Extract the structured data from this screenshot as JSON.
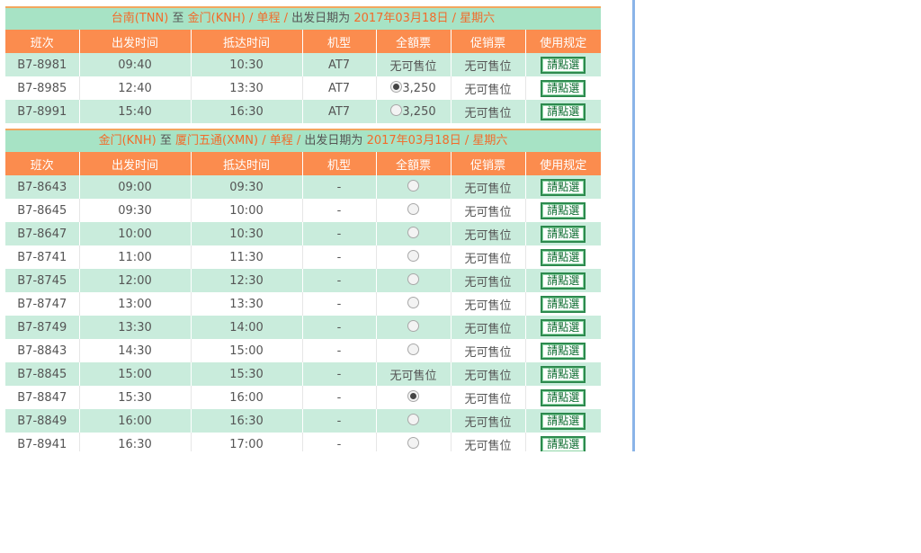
{
  "segment1": {
    "route": {
      "origin": "台南(TNN)",
      "to_word": "至",
      "dest": "金门(KNH)",
      "slash1": "/",
      "trip_type": "单程",
      "slash2": "/",
      "date_label": "出发日期为",
      "date": "2017年03月18日",
      "slash3": "/",
      "weekday": "星期六"
    },
    "headers": [
      "班次",
      "出发时间",
      "抵达时间",
      "机型",
      "全額票",
      "促销票",
      "使用规定"
    ],
    "rows": [
      {
        "flight": "B7-8981",
        "dep": "09:40",
        "arr": "10:30",
        "type": "AT7",
        "full": "无可售位",
        "full_radio": "none",
        "promo": "无可售位",
        "rule": "請點選"
      },
      {
        "flight": "B7-8985",
        "dep": "12:40",
        "arr": "13:30",
        "type": "AT7",
        "full": "3,250",
        "full_radio": "selected",
        "promo": "无可售位",
        "rule": "請點選"
      },
      {
        "flight": "B7-8991",
        "dep": "15:40",
        "arr": "16:30",
        "type": "AT7",
        "full": "3,250",
        "full_radio": "unselected",
        "promo": "无可售位",
        "rule": "請點選"
      }
    ]
  },
  "segment2": {
    "route": {
      "origin": "金门(KNH)",
      "to_word": "至",
      "dest": "厦门五通(XMN)",
      "slash1": "/",
      "trip_type": "单程",
      "slash2": "/",
      "date_label": "出发日期为",
      "date": "2017年03月18日",
      "slash3": "/",
      "weekday": "星期六"
    },
    "headers": [
      "班次",
      "出发时间",
      "抵达时间",
      "机型",
      "全額票",
      "促销票",
      "使用规定"
    ],
    "rows": [
      {
        "flight": "B7-8643",
        "dep": "09:00",
        "arr": "09:30",
        "type": "-",
        "full": "",
        "full_radio": "unselected",
        "promo": "无可售位",
        "rule": "請點選"
      },
      {
        "flight": "B7-8645",
        "dep": "09:30",
        "arr": "10:00",
        "type": "-",
        "full": "",
        "full_radio": "unselected",
        "promo": "无可售位",
        "rule": "請點選"
      },
      {
        "flight": "B7-8647",
        "dep": "10:00",
        "arr": "10:30",
        "type": "-",
        "full": "",
        "full_radio": "unselected",
        "promo": "无可售位",
        "rule": "請點選"
      },
      {
        "flight": "B7-8741",
        "dep": "11:00",
        "arr": "11:30",
        "type": "-",
        "full": "",
        "full_radio": "unselected",
        "promo": "无可售位",
        "rule": "請點選"
      },
      {
        "flight": "B7-8745",
        "dep": "12:00",
        "arr": "12:30",
        "type": "-",
        "full": "",
        "full_radio": "unselected",
        "promo": "无可售位",
        "rule": "請點選"
      },
      {
        "flight": "B7-8747",
        "dep": "13:00",
        "arr": "13:30",
        "type": "-",
        "full": "",
        "full_radio": "unselected",
        "promo": "无可售位",
        "rule": "請點選"
      },
      {
        "flight": "B7-8749",
        "dep": "13:30",
        "arr": "14:00",
        "type": "-",
        "full": "",
        "full_radio": "unselected",
        "promo": "无可售位",
        "rule": "請點選"
      },
      {
        "flight": "B7-8843",
        "dep": "14:30",
        "arr": "15:00",
        "type": "-",
        "full": "",
        "full_radio": "unselected",
        "promo": "无可售位",
        "rule": "請點選"
      },
      {
        "flight": "B7-8845",
        "dep": "15:00",
        "arr": "15:30",
        "type": "-",
        "full": "无可售位",
        "full_radio": "none",
        "promo": "无可售位",
        "rule": "請點選"
      },
      {
        "flight": "B7-8847",
        "dep": "15:30",
        "arr": "16:00",
        "type": "-",
        "full": "",
        "full_radio": "selected",
        "promo": "无可售位",
        "rule": "請點選"
      },
      {
        "flight": "B7-8849",
        "dep": "16:00",
        "arr": "16:30",
        "type": "-",
        "full": "",
        "full_radio": "unselected",
        "promo": "无可售位",
        "rule": "請點選"
      },
      {
        "flight": "B7-8941",
        "dep": "16:30",
        "arr": "17:00",
        "type": "-",
        "full": "",
        "full_radio": "unselected",
        "promo": "无可售位",
        "rule": "請點選"
      }
    ]
  },
  "colors": {
    "header_bg": "#fb8c4e",
    "route_bg": "#a7e3c5",
    "row_alt_bg": "#c9ecdc",
    "highlight_text": "#f26b2a",
    "button_border": "#2d8a4e"
  }
}
